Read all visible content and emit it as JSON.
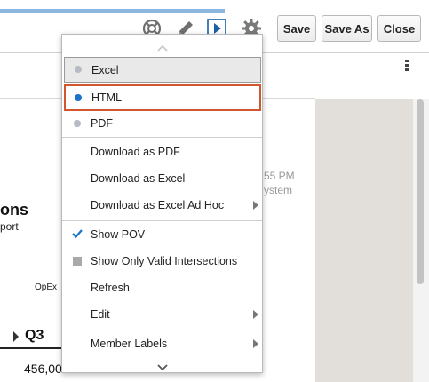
{
  "toolbar": {
    "save_label": "Save",
    "save_as_label": "Save As",
    "close_label": "Close",
    "progress": 0.52,
    "icons": [
      "lifebuoy-icon",
      "pencil-icon",
      "run-icon",
      "gear-icon"
    ]
  },
  "background": {
    "title_fragment": "ons",
    "subtitle_fragment": "port",
    "time_fragment": "55 PM",
    "system_fragment": "ystem",
    "opex_label": "OpEx",
    "column_header": "Q3",
    "cell_value": "456,00"
  },
  "menu": {
    "formats": [
      {
        "label": "Excel",
        "selected": false
      },
      {
        "label": "HTML",
        "selected": true
      },
      {
        "label": "PDF",
        "selected": false
      }
    ],
    "downloads": [
      {
        "label": "Download as PDF",
        "submenu": false
      },
      {
        "label": "Download as Excel",
        "submenu": false
      },
      {
        "label": "Download as Excel Ad Hoc",
        "submenu": true
      }
    ],
    "options": [
      {
        "label": "Show POV",
        "state": "checked"
      },
      {
        "label": "Show Only Valid Intersections",
        "state": "unchecked"
      },
      {
        "label": "Refresh",
        "state": "none"
      },
      {
        "label": "Edit",
        "state": "none",
        "submenu": true
      }
    ],
    "extras": [
      {
        "label": "Member Labels",
        "submenu": true
      }
    ]
  },
  "colors": {
    "accent": "#1a73c8",
    "highlight_border": "#d2572f",
    "dot_inactive": "#b5bcc4",
    "checkbox_gray": "#a9a9a9"
  }
}
